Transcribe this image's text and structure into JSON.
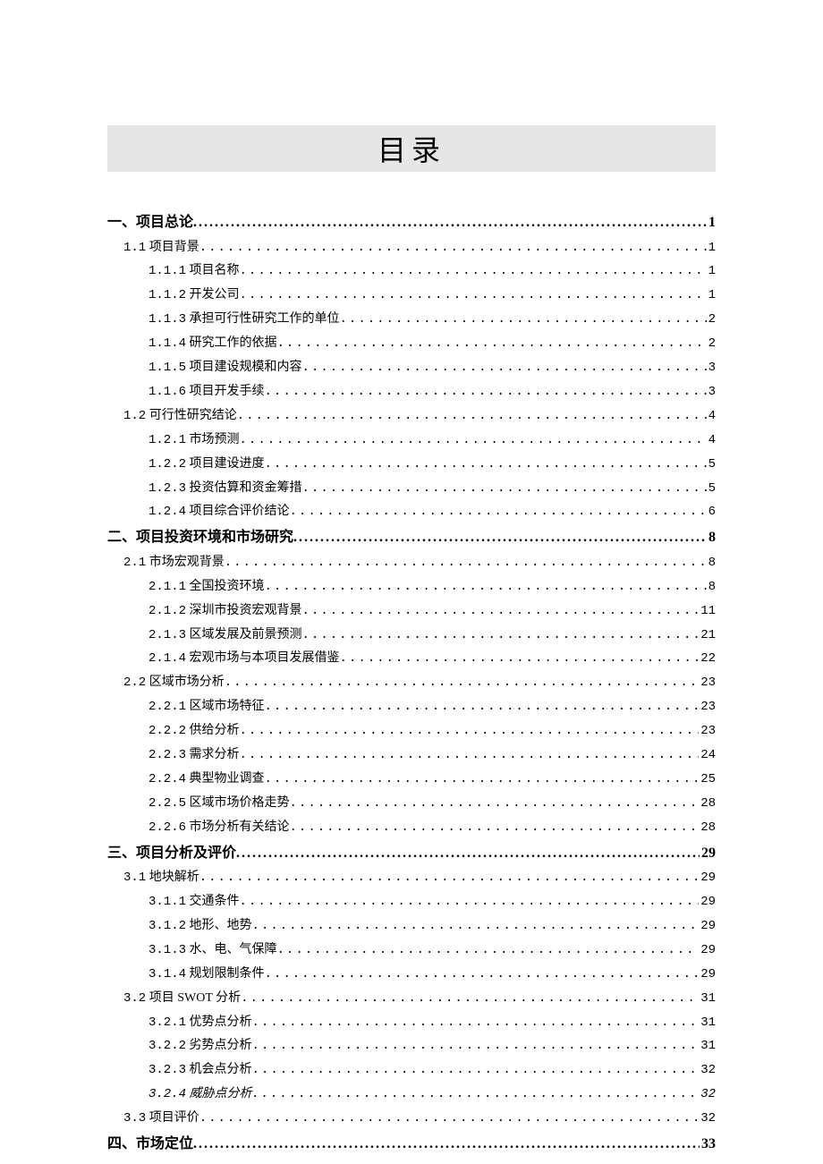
{
  "title": "目录",
  "toc": [
    {
      "level": 1,
      "text": "一、项目总论",
      "page": "1"
    },
    {
      "level": 2,
      "num": "1.1",
      "text": "项目背景",
      "page": "1"
    },
    {
      "level": 3,
      "num": "1.1.1",
      "text": "项目名称",
      "page": "1"
    },
    {
      "level": 3,
      "num": "1.1.2",
      "text": "开发公司",
      "page": "1"
    },
    {
      "level": 3,
      "num": "1.1.3",
      "text": "承担可行性研究工作的单位",
      "page": "2"
    },
    {
      "level": 3,
      "num": "1.1.4",
      "text": "研究工作的依据",
      "page": "2"
    },
    {
      "level": 3,
      "num": "1.1.5",
      "text": "项目建设规模和内容",
      "page": "3"
    },
    {
      "level": 3,
      "num": "1.1.6",
      "text": "项目开发手续",
      "page": "3"
    },
    {
      "level": 2,
      "num": "1.2",
      "text": "可行性研究结论",
      "page": "4"
    },
    {
      "level": 3,
      "num": "1.2.1",
      "text": "市场预测",
      "page": "4"
    },
    {
      "level": 3,
      "num": "1.2.2",
      "text": "项目建设进度",
      "page": "5"
    },
    {
      "level": 3,
      "num": "1.2.3",
      "text": "投资估算和资金筹措",
      "page": "5"
    },
    {
      "level": 3,
      "num": "1.2.4",
      "text": "项目综合评价结论",
      "page": "6"
    },
    {
      "level": 1,
      "text": "二、项目投资环境和市场研究",
      "page": "8"
    },
    {
      "level": 2,
      "num": "2.1",
      "text": "市场宏观背景",
      "page": "8"
    },
    {
      "level": 3,
      "num": "2.1.1",
      "text": "全国投资环境",
      "page": "8"
    },
    {
      "level": 3,
      "num": "2.1.2",
      "text": "深圳市投资宏观背景",
      "page": "11"
    },
    {
      "level": 3,
      "num": "2.1.3",
      "text": "区域发展及前景预测",
      "page": "21"
    },
    {
      "level": 3,
      "num": "2.1.4",
      "text": "宏观市场与本项目发展借鉴",
      "page": "22"
    },
    {
      "level": 2,
      "num": "2.2",
      "text": "区域市场分析",
      "page": "23"
    },
    {
      "level": 3,
      "num": "2.2.1",
      "text": "区域市场特征",
      "page": "23"
    },
    {
      "level": 3,
      "num": "2.2.2",
      "text": "供给分析",
      "page": "23"
    },
    {
      "level": 3,
      "num": "2.2.3",
      "text": "需求分析",
      "page": "24"
    },
    {
      "level": 3,
      "num": "2.2.4",
      "text": "典型物业调查",
      "page": "25"
    },
    {
      "level": 3,
      "num": "2.2.5",
      "text": "区域市场价格走势",
      "page": "28"
    },
    {
      "level": 3,
      "num": "2.2.6",
      "text": "市场分析有关结论",
      "page": "28"
    },
    {
      "level": 1,
      "text": "三、项目分析及评价",
      "page": "29"
    },
    {
      "level": 2,
      "num": "3.1",
      "text": "地块解析",
      "page": "29"
    },
    {
      "level": 3,
      "num": "3.1.1",
      "text": "交通条件",
      "page": "29"
    },
    {
      "level": 3,
      "num": "3.1.2",
      "text": "地形、地势",
      "page": "29"
    },
    {
      "level": 3,
      "num": "3.1.3",
      "text": "水、电、气保障",
      "page": "29"
    },
    {
      "level": 3,
      "num": "3.1.4",
      "text": "规划限制条件",
      "page": "29"
    },
    {
      "level": 2,
      "num": "3.2",
      "text": "项目 SWOT 分析",
      "page": "31"
    },
    {
      "level": 3,
      "num": "3.2.1",
      "text": "优势点分析",
      "page": "31"
    },
    {
      "level": 3,
      "num": "3.2.2",
      "text": "劣势点分析",
      "page": "31"
    },
    {
      "level": 3,
      "num": "3.2.3",
      "text": "机会点分析",
      "page": "32"
    },
    {
      "level": 3,
      "num": "3.2.4",
      "text": "威胁点分析",
      "page": "32",
      "italic": true
    },
    {
      "level": 2,
      "num": "3.3",
      "text": "项目评价",
      "page": "32"
    },
    {
      "level": 1,
      "text": "四、市场定位",
      "page": "33"
    }
  ]
}
